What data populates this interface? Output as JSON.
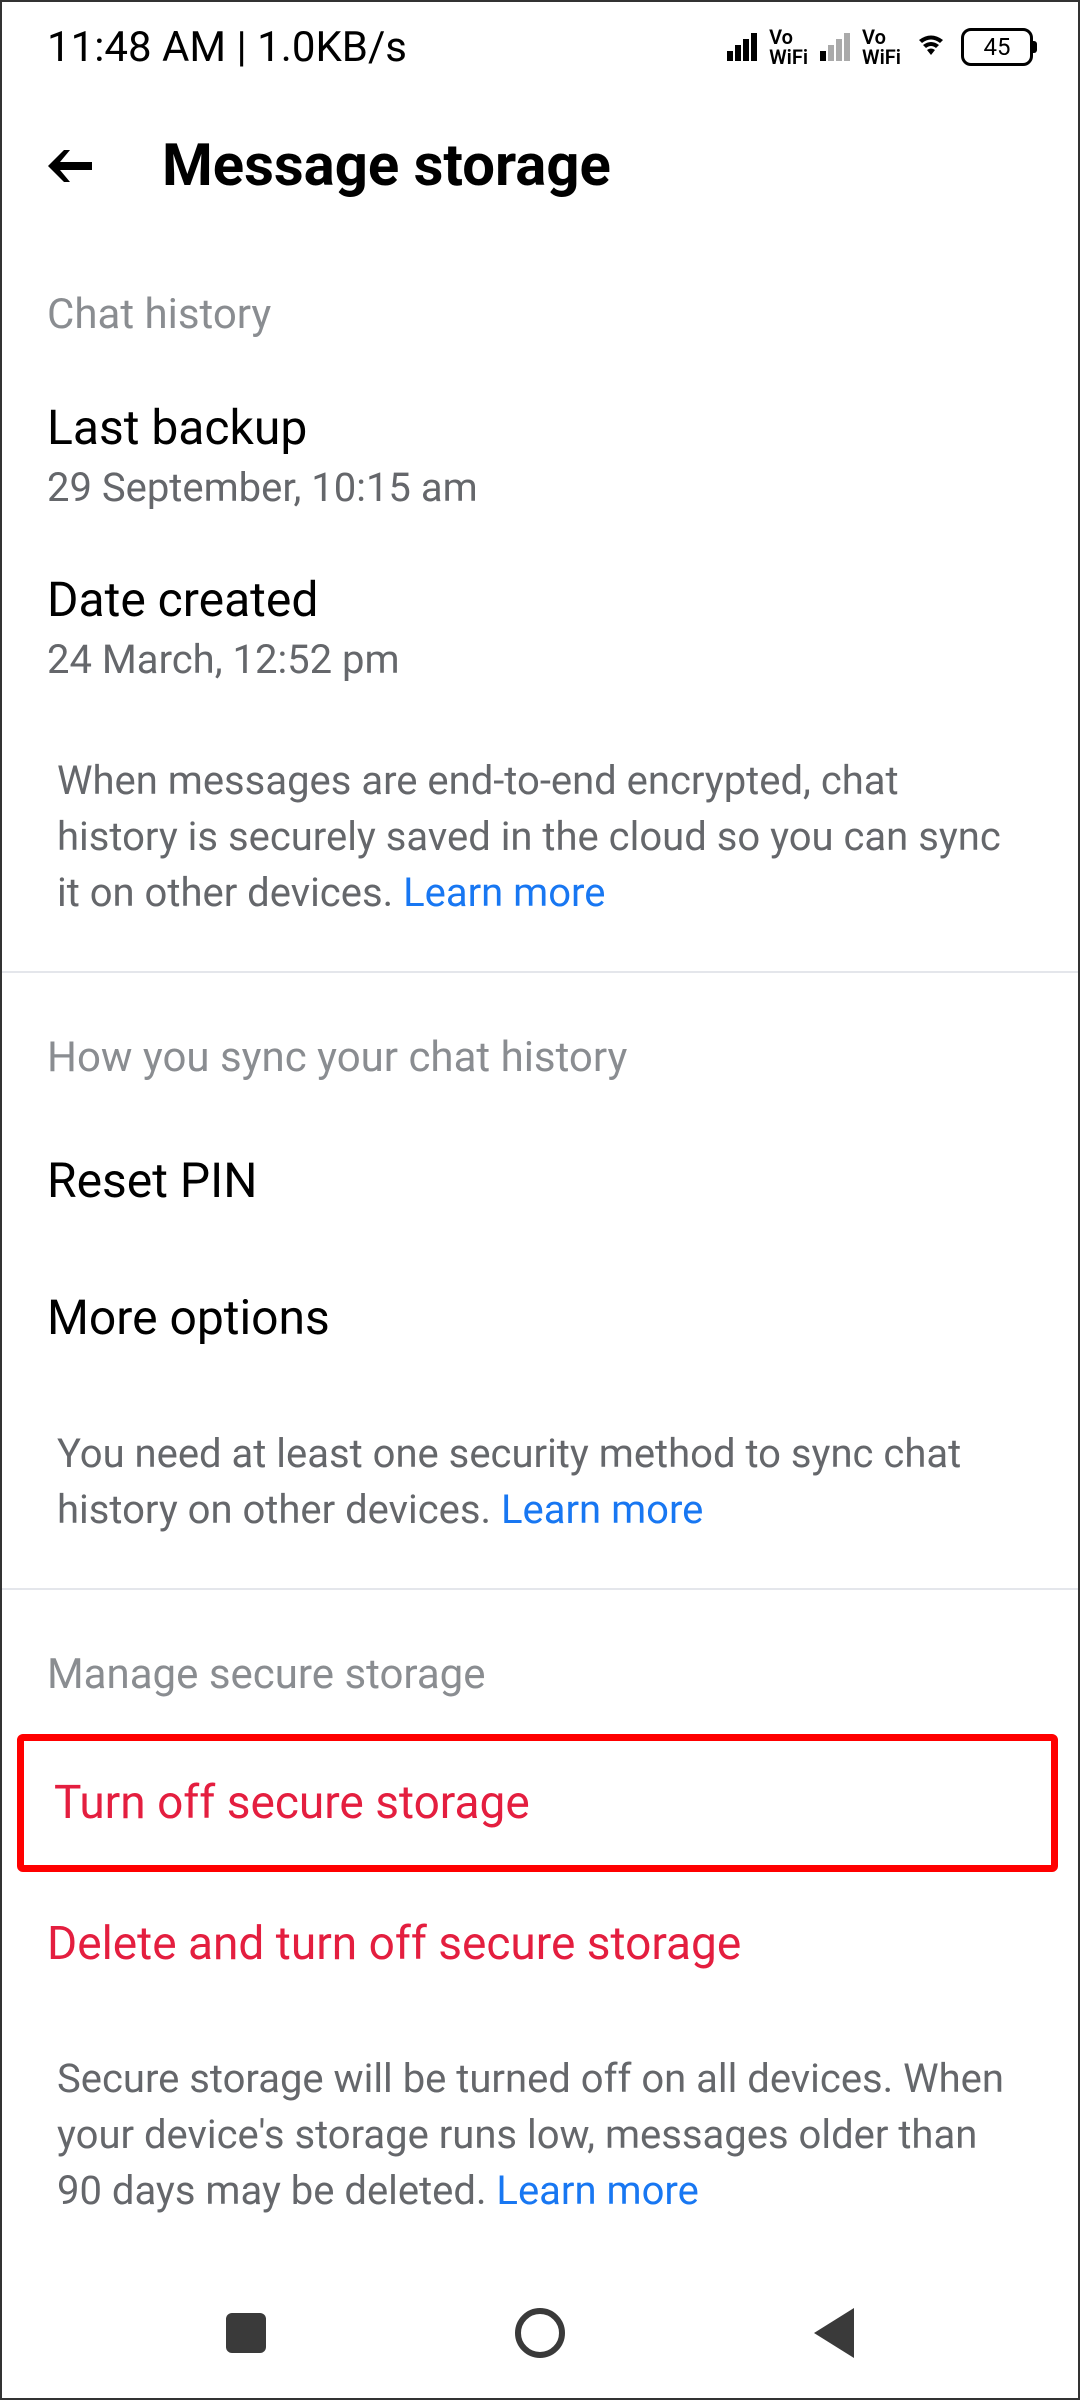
{
  "status": {
    "time": "11:48 AM",
    "speed": "1.0KB/s",
    "vowifi": "Vo",
    "vowifi2": "WiFi",
    "battery": "45"
  },
  "header": {
    "title": "Message storage"
  },
  "sections": {
    "chat_history": {
      "title": "Chat history",
      "last_backup": {
        "label": "Last backup",
        "value": "29 September, 10:15 am"
      },
      "date_created": {
        "label": "Date created",
        "value": "24 March, 12:52 pm"
      },
      "info": "When messages are end-to-end encrypted, chat history is securely saved in the cloud so you can sync it on other devices. ",
      "learn_more": "Learn more"
    },
    "sync": {
      "title": "How you sync your chat history",
      "reset_pin": "Reset PIN",
      "more_options": "More options",
      "info": "You need at least one security method to sync chat history on other devices. ",
      "learn_more": "Learn more"
    },
    "manage": {
      "title": "Manage secure storage",
      "turn_off": "Turn off secure storage",
      "delete_turn_off": "Delete and turn off secure storage",
      "info": "Secure storage will be turned off on all devices. When your device's storage runs low, messages older than 90 days may be deleted. ",
      "learn_more": "Learn more"
    }
  }
}
